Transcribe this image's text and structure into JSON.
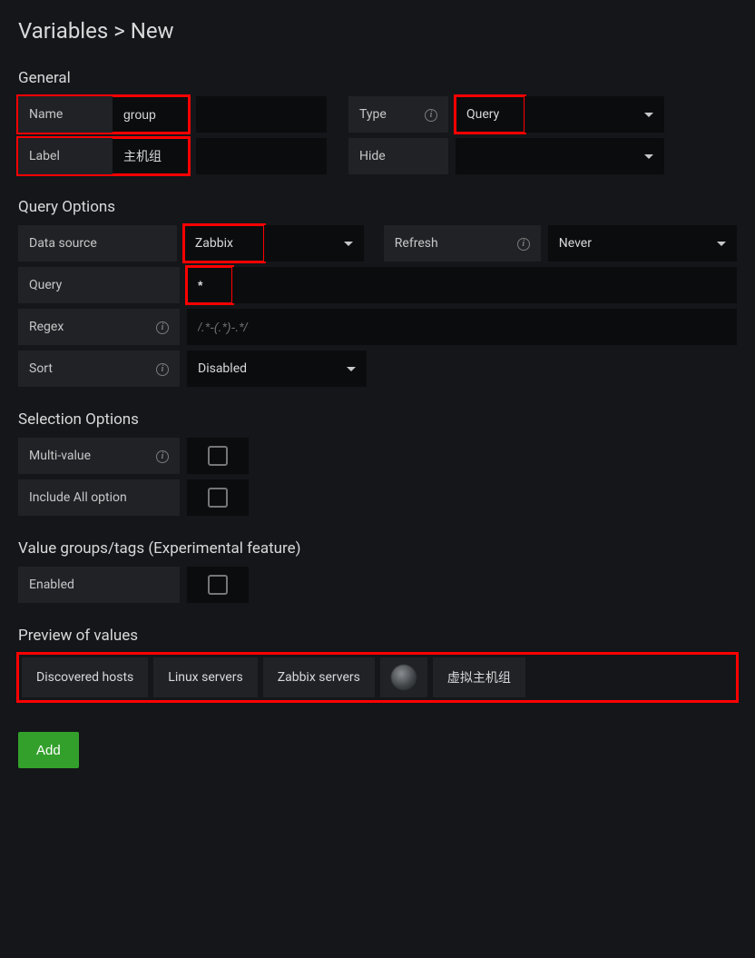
{
  "title": "Variables > New",
  "sections": {
    "general": "General",
    "queryOptions": "Query Options",
    "selectionOptions": "Selection Options",
    "valueGroups": "Value groups/tags (Experimental feature)",
    "preview": "Preview of values"
  },
  "general": {
    "nameLabel": "Name",
    "nameValue": "group",
    "labelLabel": "Label",
    "labelValue": "主机组",
    "typeLabel": "Type",
    "typeValue": "Query",
    "hideLabel": "Hide",
    "hideValue": ""
  },
  "queryOptions": {
    "dataSourceLabel": "Data source",
    "dataSourceValue": "Zabbix",
    "refreshLabel": "Refresh",
    "refreshValue": "Never",
    "queryLabel": "Query",
    "queryValue": "*",
    "regexLabel": "Regex",
    "regexPlaceholder": "/.*-(.*)-.*/",
    "regexValue": "",
    "sortLabel": "Sort",
    "sortValue": "Disabled"
  },
  "selectionOptions": {
    "multiValueLabel": "Multi-value",
    "includeAllLabel": "Include All option"
  },
  "valueGroups": {
    "enabledLabel": "Enabled"
  },
  "previewValues": {
    "v1": "Discovered hosts",
    "v2": "Linux servers",
    "v3": "Zabbix servers",
    "v4": "",
    "v5": "虚拟主机组"
  },
  "buttons": {
    "add": "Add"
  }
}
